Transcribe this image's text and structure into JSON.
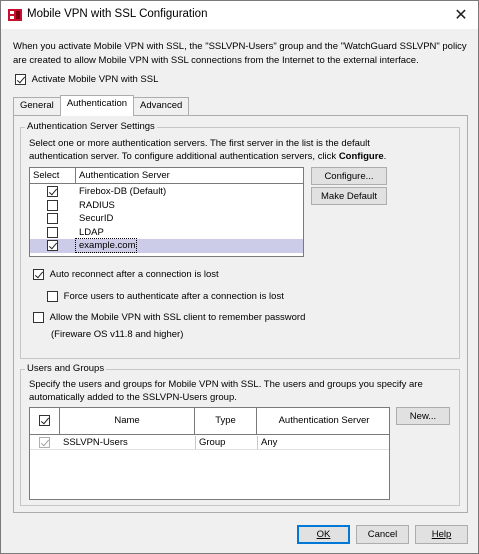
{
  "window": {
    "title": "Mobile VPN with SSL Configuration",
    "close_glyph": "✕"
  },
  "intro": "When you activate Mobile VPN with SSL, the \"SSLVPN-Users\" group and the \"WatchGuard SSLVPN\" policy are created to allow Mobile VPN with SSL connections from the Internet to the external interface.",
  "activate": {
    "label": "Activate Mobile VPN with SSL",
    "checked": true
  },
  "tabs": [
    {
      "label": "General",
      "active": false
    },
    {
      "label": "Authentication",
      "active": true
    },
    {
      "label": "Advanced",
      "active": false
    }
  ],
  "auth_servers": {
    "group_label": "Authentication Server Settings",
    "description_1": "Select one or more authentication servers. The first server in the list is the default",
    "description_2": "authentication server. To configure additional authentication servers, click",
    "description_bold": "Configure",
    "description_end": ".",
    "columns": [
      "Select",
      "Authentication Server"
    ],
    "rows": [
      {
        "name": "Firebox-DB  (Default)",
        "checked": true,
        "selected": false
      },
      {
        "name": "RADIUS",
        "checked": false,
        "selected": false
      },
      {
        "name": "SecurID",
        "checked": false,
        "selected": false
      },
      {
        "name": "LDAP",
        "checked": false,
        "selected": false
      },
      {
        "name": "example.com",
        "checked": true,
        "selected": true
      }
    ],
    "configure_button": "Configure...",
    "make_default_button": "Make Default"
  },
  "options": {
    "auto_reconnect": {
      "label": "Auto reconnect after a connection is lost",
      "checked": true
    },
    "force_auth": {
      "label": "Force users to authenticate after a connection is lost",
      "checked": false
    },
    "remember_password": {
      "label": "Allow the Mobile VPN with SSL client to remember password",
      "checked": false
    },
    "remember_note": "(Fireware OS v11.8 and higher)"
  },
  "users_groups": {
    "group_label": "Users and Groups",
    "description_1": "Specify the users and groups for Mobile VPN with SSL. The users and groups you specify are",
    "description_2": "automatically added to the SSLVPN-Users group.",
    "columns": [
      "Name",
      "Type",
      "Authentication Server"
    ],
    "rows": [
      {
        "name": "SSLVPN-Users",
        "type": "Group",
        "server": "Any",
        "checked": true
      }
    ],
    "new_button": "New..."
  },
  "footer": {
    "ok_button": "OK",
    "cancel_button": "Cancel",
    "help_button": "Help"
  },
  "colors": {
    "selected_row": "#cccce8",
    "default_button_border": "#0078d7",
    "app_icon_red": "#c8102e"
  }
}
